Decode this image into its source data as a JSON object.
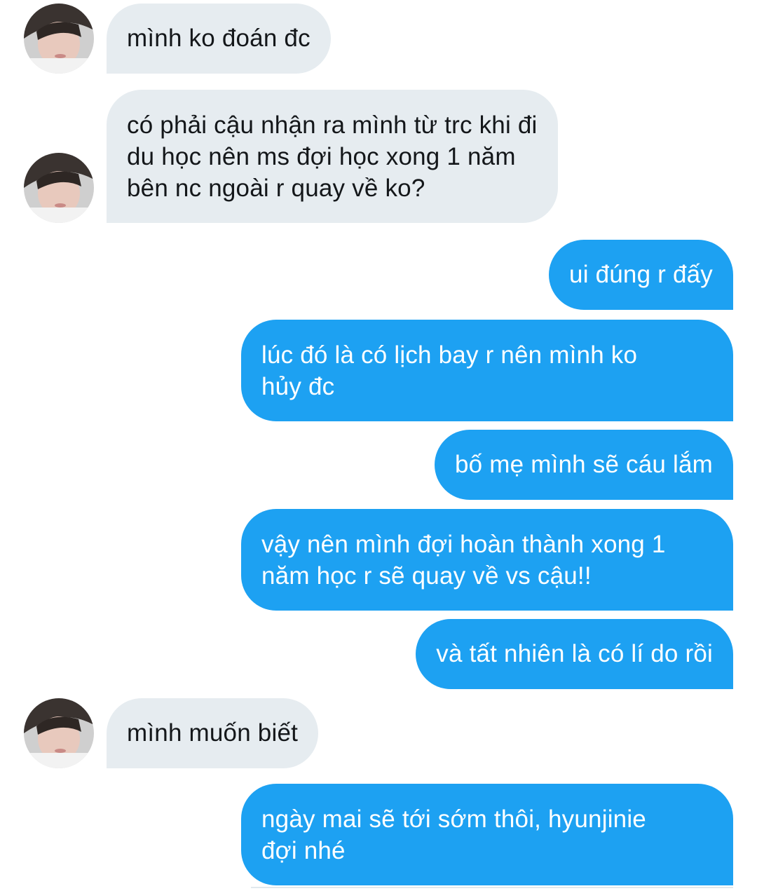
{
  "conversation": {
    "messages": [
      {
        "direction": "incoming",
        "text": "mình ko đoán đc",
        "avatar": "user-avatar"
      },
      {
        "direction": "incoming",
        "text": "có phải cậu nhận ra mình từ trc khi đi\ndu học nên ms đợi học xong 1 năm\nbên nc ngoài r quay về ko?",
        "avatar": "user-avatar"
      },
      {
        "direction": "outgoing",
        "text": "ui đúng r đấy"
      },
      {
        "direction": "outgoing",
        "text": "lúc đó là có lịch bay r nên mình ko\nhủy đc"
      },
      {
        "direction": "outgoing",
        "text": "bố mẹ mình sẽ cáu lắm"
      },
      {
        "direction": "outgoing",
        "text": "vậy nên mình đợi hoàn thành xong 1\nnăm học r sẽ quay về vs cậu!!"
      },
      {
        "direction": "outgoing",
        "text": "và tất nhiên là có lí do rồi"
      },
      {
        "direction": "incoming",
        "text": "mình muốn biết",
        "avatar": "user-avatar"
      },
      {
        "direction": "outgoing",
        "text": "ngày mai sẽ tới sớm thôi, hyunjinie\nđợi nhé"
      }
    ]
  },
  "colors": {
    "incoming_bubble": "#e6ecf0",
    "incoming_text": "#14171a",
    "outgoing_bubble": "#1da1f2",
    "outgoing_text": "#ffffff",
    "background": "#ffffff"
  }
}
